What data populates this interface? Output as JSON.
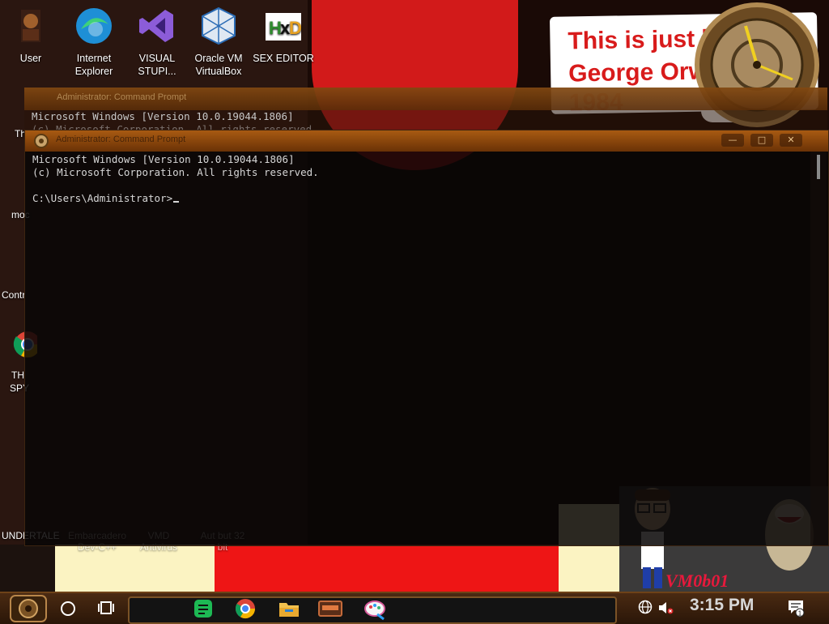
{
  "desktop": {
    "icons_top": [
      {
        "label": "User"
      },
      {
        "label": "Internet Explorer"
      },
      {
        "label": "VISUAL STUPI..."
      },
      {
        "label": "Oracle VM VirtualBox"
      },
      {
        "label": "SEX EDITOR"
      }
    ],
    "left_labels": [
      "Th",
      "moc",
      "Contr",
      "TH",
      "SPY",
      "UNDERTALE"
    ],
    "faded_labels": [
      "Embarcadero Dev-C++",
      "VMD Antivirus",
      "Aut but 32 bit"
    ],
    "wallpaper_note": [
      "This is just lik",
      "George Orwell's",
      "1984"
    ],
    "vm_text": "VM0b01"
  },
  "cmd_back": {
    "title": "Administrator: Command Prompt",
    "lines": [
      "Microsoft Windows [Version 10.0.19044.1806]",
      "(c) Microsoft Corporation. All rights reserved."
    ]
  },
  "cmd_front": {
    "title": "Administrator: Command Prompt",
    "lines": [
      "Microsoft Windows [Version 10.0.19044.1806]",
      "(c) Microsoft Corporation. All rights reserved.",
      "",
      "C:\\Users\\Administrator>"
    ],
    "buttons": {
      "minimize": "—",
      "maximize": "□",
      "close": "✕"
    }
  },
  "taskbar": {
    "apps": [
      {
        "icon": "notepad-green-icon"
      },
      {
        "icon": "chrome-icon"
      },
      {
        "icon": "file-explorer-icon"
      },
      {
        "icon": "device-app-icon"
      },
      {
        "icon": "paint-icon"
      }
    ],
    "time": "3:15 PM",
    "notification_count": "1"
  },
  "colors": {
    "accent": "#8a4d12",
    "wall_red": "#d21a1a",
    "clock_text": "#d8d8d8"
  }
}
